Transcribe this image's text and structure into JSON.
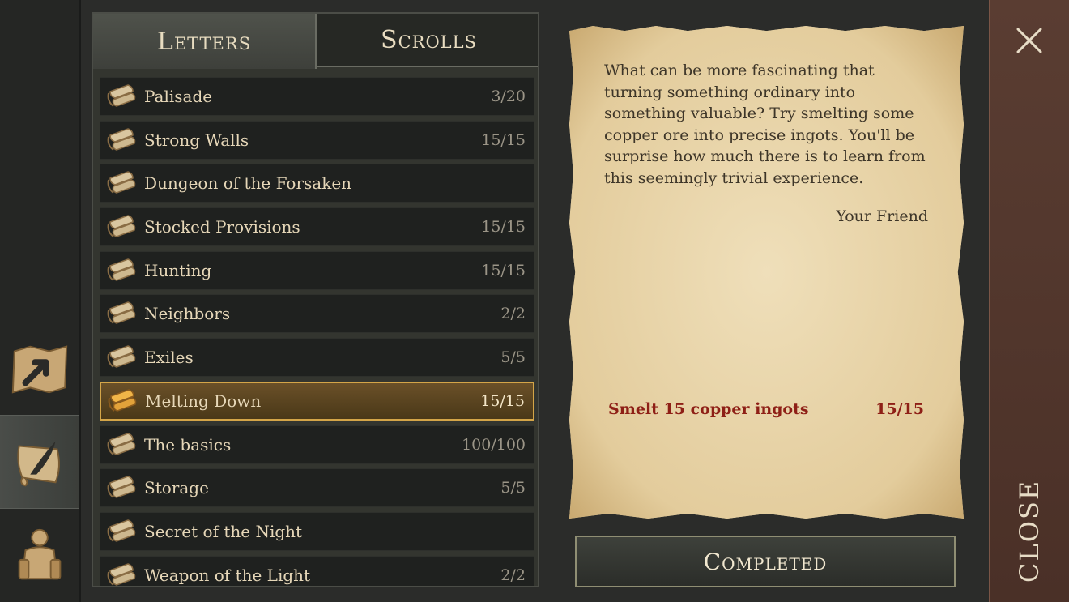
{
  "tabs": [
    {
      "label": "Letters",
      "active": true
    },
    {
      "label": "Scrolls",
      "active": false
    }
  ],
  "quests": [
    {
      "name": "Palisade",
      "progress": "3/20"
    },
    {
      "name": "Strong Walls",
      "progress": "15/15"
    },
    {
      "name": "Dungeon of the Forsaken",
      "progress": ""
    },
    {
      "name": "Stocked Provisions",
      "progress": "15/15"
    },
    {
      "name": "Hunting",
      "progress": "15/15"
    },
    {
      "name": "Neighbors",
      "progress": "2/2"
    },
    {
      "name": "Exiles",
      "progress": "5/5"
    },
    {
      "name": "Melting Down",
      "progress": "15/15",
      "selected": true
    },
    {
      "name": "The basics",
      "progress": "100/100"
    },
    {
      "name": "Storage",
      "progress": "5/5"
    },
    {
      "name": "Secret of the Night",
      "progress": ""
    },
    {
      "name": "Weapon of the Light",
      "progress": "2/2"
    }
  ],
  "letter": {
    "body": "What can be more fascinating that turning something ordinary into something valuable? Try smelting some copper ore into precise ingots. You'll be surprise how much there is to learn from this seemingly trivial experience.",
    "signature": "Your Friend",
    "objective": "Smelt 15 copper ingots",
    "objective_progress": "15/15"
  },
  "completed_label": "Completed",
  "close_label": "CLOSE",
  "rail_icons": [
    "map-arrow-icon",
    "scroll-quill-icon",
    "character-backpack-icon"
  ],
  "colors": {
    "accent_gold": "#d4a548",
    "objective_red": "#8e1f16",
    "parchment": "#e9d7ae"
  }
}
